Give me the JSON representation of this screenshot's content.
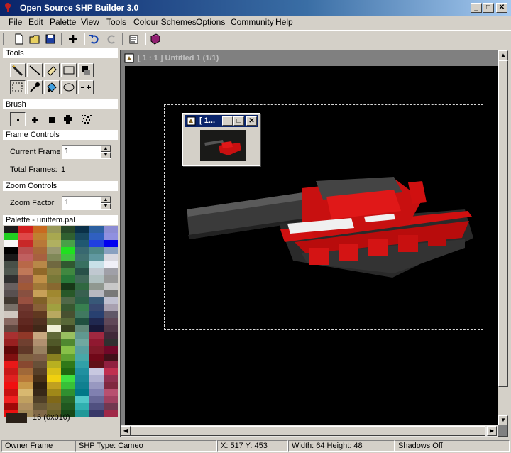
{
  "window": {
    "title": "Open Source SHP Builder 3.0",
    "caption_buttons": [
      "minimize",
      "maximize",
      "close"
    ]
  },
  "menu": [
    {
      "label": "File",
      "key": "F"
    },
    {
      "label": "Edit",
      "key": "E"
    },
    {
      "label": "Palette",
      "key": "P"
    },
    {
      "label": "View",
      "key": "V"
    },
    {
      "label": "Tools",
      "key": "T"
    },
    {
      "label": "Colour Schemes",
      "key": "C"
    },
    {
      "label": "Options",
      "key": "O"
    },
    {
      "label": "Community",
      "key": "C"
    },
    {
      "label": "Help",
      "key": "H"
    }
  ],
  "toolbar": [
    "new-file-icon",
    "open-folder-icon",
    "save-disk-icon",
    "add-frame-icon",
    "undo-icon",
    "redo-icon",
    "properties-icon",
    "book-icon"
  ],
  "tools_panel": {
    "heading": "Tools",
    "tools": [
      "pencil-icon",
      "line-icon",
      "eraser-icon",
      "rectangle-icon",
      "darken-lighten-icon",
      "select-rect-icon",
      "dropper-icon",
      "fill-bucket-icon",
      "ellipse-icon",
      "crash-icon"
    ]
  },
  "brush_panel": {
    "heading": "Brush",
    "sizes": [
      "brush-1",
      "brush-2",
      "brush-3",
      "brush-4",
      "brush-pattern"
    ]
  },
  "frame_controls": {
    "heading": "Frame Controls",
    "current_frame_label": "Current Frame",
    "current_frame_value": "1",
    "total_frames_label": "Total Frames:",
    "total_frames_value": "1"
  },
  "zoom_controls": {
    "heading": "Zoom Controls",
    "zoom_label": "Zoom Factor",
    "zoom_value": "1"
  },
  "palette": {
    "heading": "Palette - unittem.pal",
    "selected_label": "16 (0x010)",
    "selected_color": "#2a2018",
    "colors": [
      "#1c1c1c",
      "#d42020",
      "#c86a20",
      "#989858",
      "#284828",
      "#0a3048",
      "#2c60a0",
      "#8c8cd4",
      "#20d020",
      "#e04848",
      "#c08030",
      "#a8a850",
      "#306030",
      "#184860",
      "#3060c0",
      "#9090e0",
      "#f8f8f8",
      "#c82828",
      "#b87838",
      "#b0b060",
      "#48a048",
      "#205870",
      "#2040e0",
      "#0000f0",
      "#000000",
      "#b85050",
      "#a86838",
      "#989870",
      "#20e020",
      "#386870",
      "#508888",
      "#88a0c0",
      "#181818",
      "#c06060",
      "#a86040",
      "#808858",
      "#40c040",
      "#407070",
      "#6098a0",
      "#d8d8e0",
      "#485048",
      "#b86848",
      "#b88848",
      "#706840",
      "#305830",
      "#387060",
      "#c8e0e8",
      "#f0f0f8",
      "#505850",
      "#c07858",
      "#906828",
      "#888040",
      "#408840",
      "#285048",
      "#c0c8d0",
      "#a0a0a8",
      "#303030",
      "#985848",
      "#c09048",
      "#787838",
      "#287838",
      "#406858",
      "#b0c0c0",
      "#989898",
      "#686060",
      "#a05838",
      "#a07838",
      "#886830",
      "#183818",
      "#306840",
      "#909890",
      "#c8c8c8",
      "#585050",
      "#885040",
      "#c8a058",
      "#a08830",
      "#285828",
      "#386050",
      "#b8b8c0",
      "#787878",
      "#403830",
      "#985040",
      "#806028",
      "#a89040",
      "#506848",
      "#2c6048",
      "#385878",
      "#c0c0d0",
      "#787068",
      "#703830",
      "#886038",
      "#a0a040",
      "#385830",
      "#388050",
      "#384870",
      "#a8a0b0",
      "#d0c8c0",
      "#683028",
      "#603820",
      "#b8a860",
      "#485030",
      "#407860",
      "#284070",
      "#605868",
      "#886860",
      "#602820",
      "#503020",
      "#707840",
      "#586838",
      "#205040",
      "#202850",
      "#604858",
      "#604840",
      "#582018",
      "#402818",
      "#f0f0d8",
      "#384020",
      "#608878",
      "#181838",
      "#503848",
      "#a83030",
      "#903828",
      "#c8a880",
      "#606838",
      "#98c060",
      "#609890",
      "#a02840",
      "#402838",
      "#982020",
      "#704030",
      "#b09070",
      "#505828",
      "#508830",
      "#70a8a0",
      "#901830",
      "#303030",
      "#600808",
      "#603828",
      "#988060",
      "#404018",
      "#88c048",
      "#58a0a0",
      "#801828",
      "#700828",
      "#801010",
      "#806040",
      "#806048",
      "#888020",
      "#60a030",
      "#48a8a8",
      "#700818",
      "#401018",
      "#e81818",
      "#884830",
      "#685038",
      "#b8b020",
      "#307818",
      "#30a0a8",
      "#601018",
      "#902040",
      "#c81818",
      "#a06838",
      "#584028",
      "#d8c018",
      "#206810",
      "#2090a0",
      "#c8c8e0",
      "#c03050",
      "#e02020",
      "#b87838",
      "#483018",
      "#f0d010",
      "#40e040",
      "#188898",
      "#b0b0d0",
      "#903050",
      "#f01010",
      "#c89848",
      "#302010",
      "#c0a020",
      "#38c038",
      "#108090",
      "#9898c0",
      "#802840",
      "#c81010",
      "#d8b870",
      "#382818",
      "#a08818",
      "#309030",
      "#007888",
      "#8080b0",
      "#b85070",
      "#f02020",
      "#c0a060",
      "#504028",
      "#806818",
      "#286828",
      "#50c8c8",
      "#686898",
      "#a04060",
      "#a00808",
      "#b09060",
      "#685838",
      "#786830",
      "#205820",
      "#30b0b0",
      "#505080",
      "#703850",
      "#e81010",
      "#a08858",
      "#806848",
      "#686028",
      "#184818",
      "#209898",
      "#383868",
      "#a02848"
    ]
  },
  "document": {
    "title": "[ 1 : 1 ] Untitled 1 (1/1)",
    "preview_title": "[ 1..."
  },
  "status": {
    "owner": "Owner Frame",
    "shp_type": "SHP Type: Cameo",
    "coords": "X: 517 Y: 453",
    "size": "Width: 64 Height: 48",
    "shadows": "Shadows Off"
  }
}
